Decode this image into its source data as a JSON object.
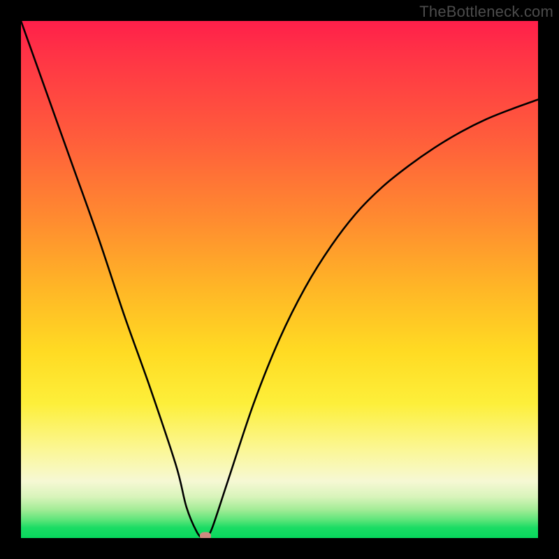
{
  "watermark": "TheBottleneck.com",
  "chart_data": {
    "type": "line",
    "title": "",
    "xlabel": "",
    "ylabel": "",
    "xlim": [
      0,
      1
    ],
    "ylim": [
      0,
      1
    ],
    "series": [
      {
        "name": "curve",
        "x": [
          0.0,
          0.05,
          0.1,
          0.15,
          0.2,
          0.25,
          0.3,
          0.32,
          0.34,
          0.352,
          0.36,
          0.37,
          0.4,
          0.45,
          0.5,
          0.55,
          0.6,
          0.65,
          0.7,
          0.75,
          0.8,
          0.85,
          0.9,
          0.95,
          1.0
        ],
        "values": [
          1.0,
          0.86,
          0.72,
          0.58,
          0.43,
          0.29,
          0.14,
          0.06,
          0.012,
          0.0,
          0.005,
          0.02,
          0.11,
          0.26,
          0.385,
          0.485,
          0.565,
          0.63,
          0.68,
          0.72,
          0.755,
          0.785,
          0.81,
          0.83,
          0.848
        ]
      }
    ],
    "marker": {
      "x": 0.357,
      "y": 0.0
    },
    "gradient_stops": [
      {
        "pos": 0.0,
        "color": "#ff1f4a"
      },
      {
        "pos": 0.38,
        "color": "#ff8a30"
      },
      {
        "pos": 0.64,
        "color": "#ffdb23"
      },
      {
        "pos": 0.89,
        "color": "#f6f8d4"
      },
      {
        "pos": 1.0,
        "color": "#07d85d"
      }
    ]
  }
}
